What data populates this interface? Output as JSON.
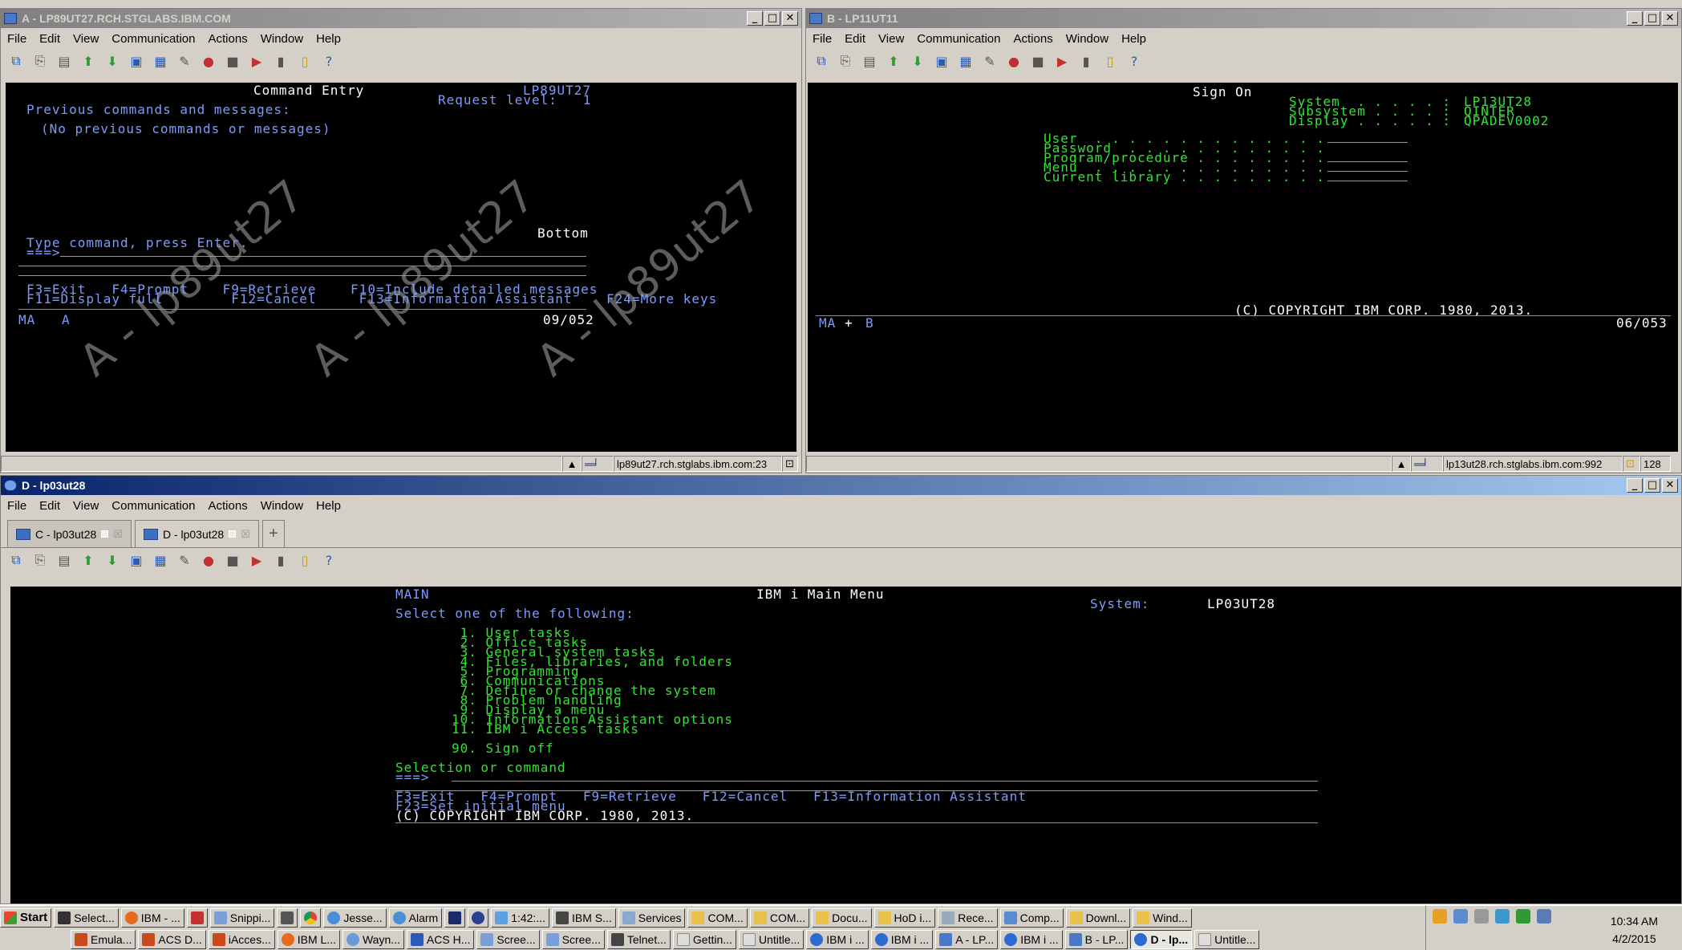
{
  "winA": {
    "title": "A - LP89UT27.RCH.STGLABS.IBM.COM",
    "screen": {
      "title": "Command Entry",
      "system": "LP89UT27",
      "request": "Request level:   1",
      "prev": "Previous commands and messages:",
      "none": "(No previous commands or messages)",
      "bottom": "Bottom",
      "type": "Type command, press Enter.",
      "prompt": "===>",
      "fkeys1": "F3=Exit   F4=Prompt    F9=Retrieve    F10=Include detailed messages",
      "fkeys2": "F11=Display full        F12=Cancel     F13=Information Assistant    F24=More keys",
      "oia_left": "MA",
      "oia_sess": "A",
      "oia_pos": "09/052",
      "watermark": "A - lp89ut27"
    },
    "host": "lp89ut27.rch.stglabs.ibm.com:23"
  },
  "winB": {
    "title": "B - LP11UT11",
    "screen": {
      "title": "Sign On",
      "system_label": "System  . . . . . :",
      "system_value": "LP13UT28",
      "subsystem_label": "Subsystem . . . . :",
      "subsystem_value": "QINTER",
      "display_label": "Display . . . . . :",
      "display_value": "QPADEV0002",
      "user": "User  . . . . . . . . . . . . . .",
      "password": "Password  . . . . . . . . . . . .",
      "program": "Program/procedure . . . . . . . .",
      "menu": "Menu  . . . . . . . . . . . . . .",
      "library": "Current library . . . . . . . . .",
      "copyright": "(C) COPYRIGHT IBM CORP. 1980, 2013.",
      "oia_left": "MA",
      "oia_plus": "+",
      "oia_sess": "B",
      "oia_pos": "06/053"
    },
    "host": "lp13ut28.rch.stglabs.ibm.com:992",
    "count": "128"
  },
  "winD": {
    "title": "D - lp03ut28",
    "tabs": [
      "C - lp03ut28",
      "D - lp03ut28"
    ],
    "screen": {
      "menu_id": "MAIN",
      "title": "IBM i Main Menu",
      "system_label": "System:",
      "system_value": "LP03UT28",
      "select": "Select one of the following:",
      "items": [
        " 1. User tasks",
        " 2. Office tasks",
        " 3. General system tasks",
        " 4. Files, libraries, and folders",
        " 5. Programming",
        " 6. Communications",
        " 7. Define or change the system",
        " 8. Problem handling",
        " 9. Display a menu",
        "10. Information Assistant options",
        "11. IBM i Access tasks"
      ],
      "signoff": "90. Sign off",
      "selection": "Selection or command",
      "prompt": "===>",
      "fkeys1": "F3=Exit   F4=Prompt   F9=Retrieve   F12=Cancel   F13=Information Assistant",
      "fkeys2": "F23=Set initial menu",
      "copyright": "(C) COPYRIGHT IBM CORP. 1980, 2013."
    }
  },
  "menu": [
    "File",
    "Edit",
    "View",
    "Communication",
    "Actions",
    "Window",
    "Help"
  ],
  "taskbar": {
    "start": "Start",
    "row1": [
      "Select...",
      "IBM - ...",
      "",
      "Snippi...",
      "",
      "",
      "Jesse...",
      "Alarm",
      "",
      "",
      "1:42:...",
      "IBM S...",
      "Services",
      "COM...",
      "COM...",
      "Docu...",
      "HoD i...",
      "Rece...",
      "Comp...",
      "Downl...",
      "Wind..."
    ],
    "row2": [
      "Emula...",
      "ACS D...",
      "iAcces...",
      "IBM L...",
      "Wayn...",
      "ACS H...",
      "Scree...",
      "Scree...",
      "Telnet...",
      "Gettin...",
      "Untitle...",
      "IBM i ...",
      "IBM i ...",
      "A - LP...",
      "IBM i ...",
      "B - LP...",
      "D - lp...",
      "Untitle..."
    ],
    "time": "10:34 AM",
    "date": "4/2/2015"
  }
}
